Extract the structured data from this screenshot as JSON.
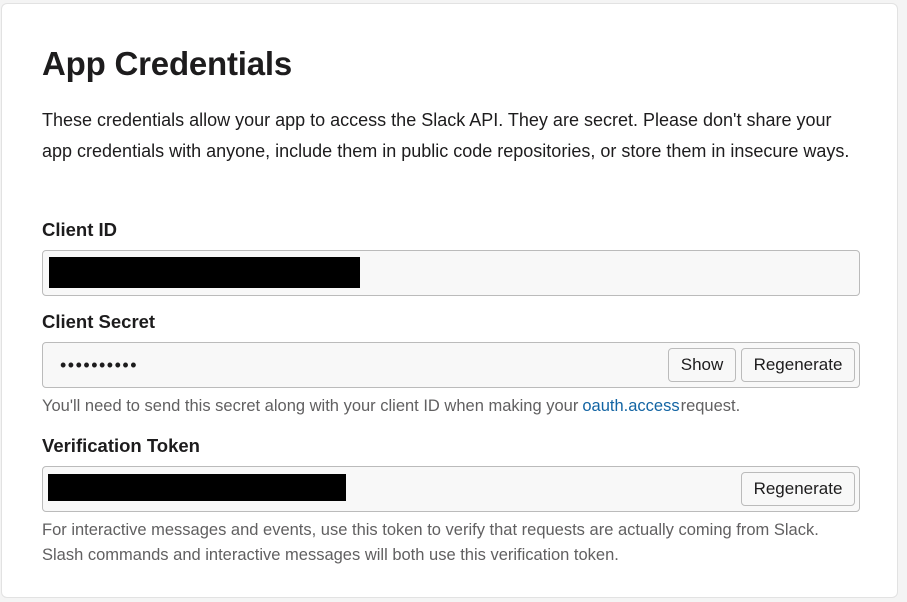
{
  "section": {
    "title": "App Credentials",
    "description": "These credentials allow your app to access the Slack API. They are secret. Please don't share your app credentials with anyone, include them in public code repositories, or store them in insecure ways."
  },
  "client_id": {
    "label": "Client ID"
  },
  "client_secret": {
    "label": "Client Secret",
    "masked_value": "••••••••••",
    "show_label": "Show",
    "regenerate_label": "Regenerate",
    "help_before": "You'll need to send this secret along with your client ID when making your",
    "help_link": "oauth.access",
    "help_after": "request."
  },
  "verification_token": {
    "label": "Verification Token",
    "regenerate_label": "Regenerate",
    "help": "For interactive messages and events, use this token to verify that requests are actually coming from Slack. Slash commands and interactive messages will both use this verification token."
  },
  "colors": {
    "link": "#1264a3",
    "muted_text": "#616061",
    "field_background": "#f8f8f8",
    "redaction": "#000000"
  }
}
